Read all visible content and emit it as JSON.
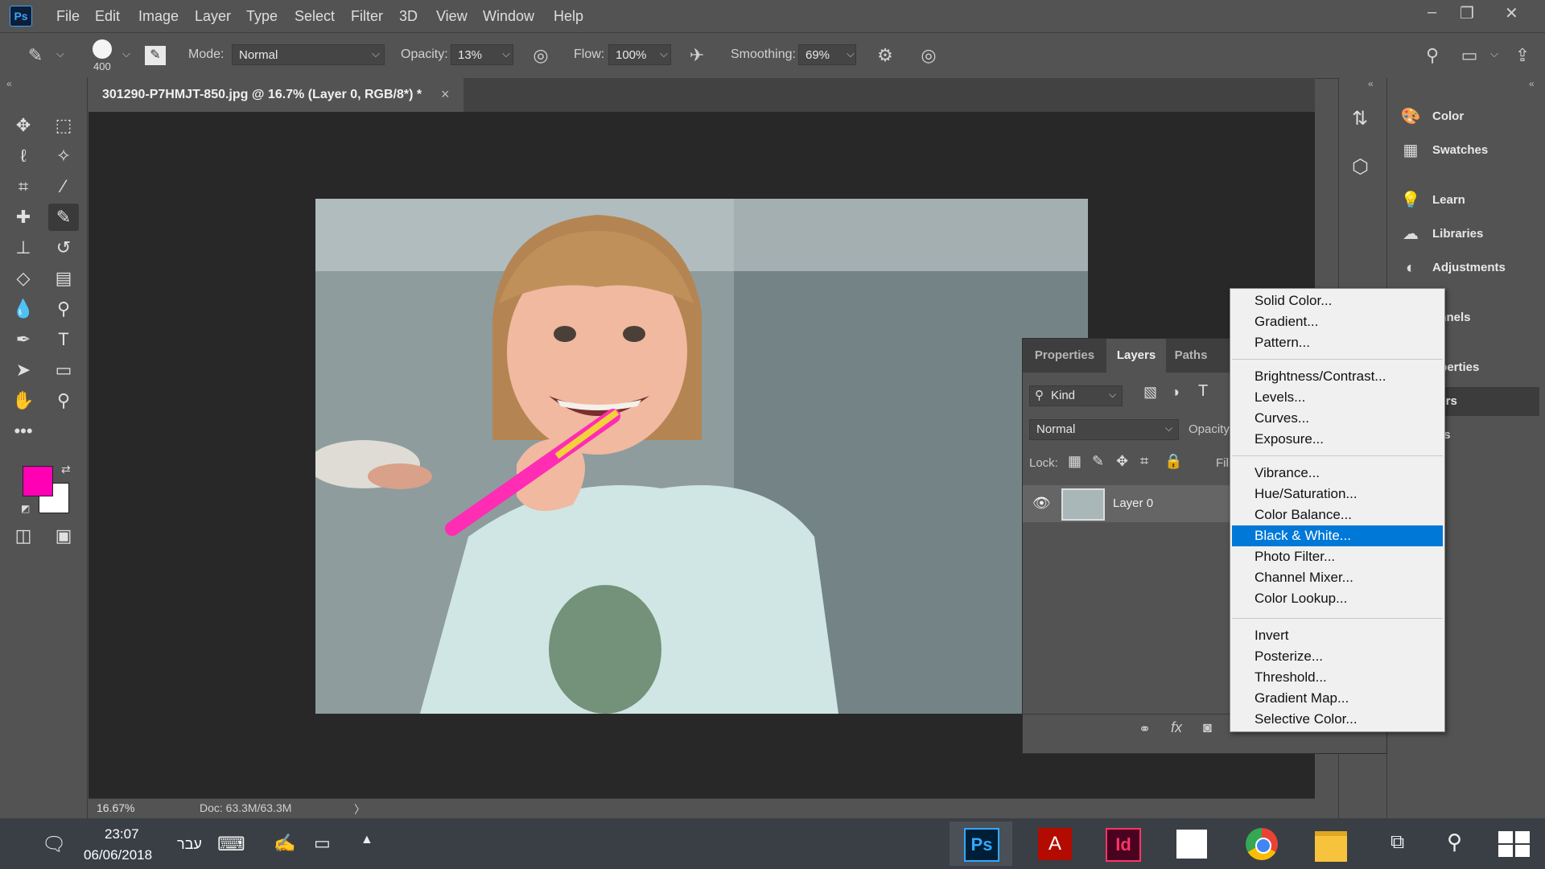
{
  "app": {
    "logo": "Ps"
  },
  "menubar": {
    "items": [
      "File",
      "Edit",
      "Image",
      "Layer",
      "Type",
      "Select",
      "Filter",
      "3D",
      "View",
      "Window",
      "Help"
    ],
    "window_controls": [
      "minimize-icon",
      "restore-icon",
      "close-icon"
    ]
  },
  "options": {
    "brush_size": "400",
    "mode_label": "Mode:",
    "mode_value": "Normal",
    "opacity_label": "Opacity:",
    "opacity_value": "13%",
    "flow_label": "Flow:",
    "flow_value": "100%",
    "smoothing_label": "Smoothing:",
    "smoothing_value": "69%"
  },
  "colors": {
    "foreground": "#ff00b4",
    "background": "#ffffff",
    "accent": "#0078d7"
  },
  "document": {
    "tab_title": "301290-P7HMJT-850.jpg @ 16.7% (Layer 0, RGB/8*) *",
    "close": "×"
  },
  "status": {
    "zoom": "16.67%",
    "doc": "Doc: 63.3M/63.3M",
    "arrow": "〉"
  },
  "dock": {
    "items": [
      {
        "label": "Color",
        "icon": "palette-icon"
      },
      {
        "label": "Swatches",
        "icon": "grid-icon"
      },
      {
        "label": "Learn",
        "icon": "bulb-icon"
      },
      {
        "label": "Libraries",
        "icon": "cloud-icon"
      },
      {
        "label": "Adjustments",
        "icon": "contrast-icon"
      },
      {
        "label": "annels",
        "icon": "channels-icon"
      },
      {
        "label": "operties",
        "icon": "properties-icon"
      },
      {
        "label": "yers",
        "icon": "layers-icon"
      },
      {
        "label": "ths",
        "icon": "paths-icon"
      }
    ]
  },
  "layers_panel": {
    "tabs": [
      "Properties",
      "Layers",
      "Paths"
    ],
    "active_tab": "Layers",
    "kind_label": "Kind",
    "blend_mode": "Normal",
    "opacity_label": "Opacity",
    "lock_label": "Lock:",
    "fill_label": "Fill",
    "layers": [
      {
        "name": "Layer 0",
        "visible": true
      }
    ]
  },
  "adjustment_menu": {
    "groups": [
      [
        "Solid Color...",
        "Gradient...",
        "Pattern..."
      ],
      [
        "Brightness/Contrast...",
        "Levels...",
        "Curves...",
        "Exposure..."
      ],
      [
        "Vibrance...",
        "Hue/Saturation...",
        "Color Balance...",
        "Black & White...",
        "Photo Filter...",
        "Channel Mixer...",
        "Color Lookup..."
      ],
      [
        "Invert",
        "Posterize...",
        "Threshold...",
        "Gradient Map...",
        "Selective Color..."
      ]
    ],
    "selected": "Black & White..."
  },
  "taskbar": {
    "time": "23:07",
    "date": "06/06/2018",
    "language": "עבר",
    "apps": [
      {
        "label": "Ps",
        "color": "#31a8ff",
        "bg": "#001e36"
      },
      {
        "label": "A",
        "color": "#ffffff",
        "bg": "#b30b00"
      },
      {
        "label": "Id",
        "color": "#ff3366",
        "bg": "#49021f"
      },
      {
        "label": "",
        "color": "#ffffff",
        "bg": "#ffffff"
      },
      {
        "label": "",
        "color": "#ffffff",
        "bg": "#4285f4"
      },
      {
        "label": "",
        "color": "#f8c33c",
        "bg": "#f8c33c"
      }
    ]
  }
}
